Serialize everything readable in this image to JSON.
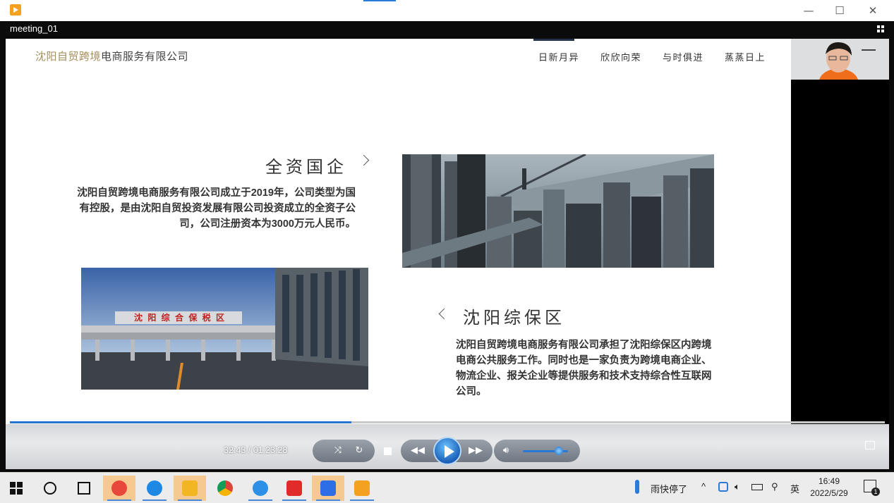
{
  "window": {
    "title": "meeting_01",
    "minimize": "—",
    "maximize": "☐",
    "close": "✕"
  },
  "slide": {
    "company_prefix": "沈阳自贸跨境",
    "company_suffix": "电商服务有限公司",
    "nav": [
      "日新月异",
      "欣欣向荣",
      "与时俱进",
      "蒸蒸日上"
    ],
    "section1": {
      "heading": "全资国企",
      "text": "沈阳自贸跨境电商服务有限公司成立于2019年，公司类型为国有控股，是由沈阳自贸投资发展有限公司投资成立的全资子公司，公司注册资本为3000万元人民币。"
    },
    "section2": {
      "heading": "沈阳综保区",
      "text": "沈阳自贸跨境电商服务有限公司承担了沈阳综保区内跨境电商公共服务工作。同时也是一家负责为跨境电商企业、物流企业、报关企业等提供服务和技术支持综合性互联网公司。"
    },
    "gate_sign": "沈 阳 综 合 保 税 区"
  },
  "player": {
    "time": "32:43 / 01:23:28",
    "progress": 0.39,
    "volume": 0.8
  },
  "taskbar": {
    "apps": [
      "start",
      "search",
      "task-view",
      "paint",
      "ie",
      "file-explorer",
      "chrome",
      "sogou",
      "wps",
      "meeting",
      "player"
    ],
    "weather": "雨快停了",
    "ime": "英",
    "time": "16:49",
    "date": "2022/5/29",
    "notifications": "1"
  }
}
